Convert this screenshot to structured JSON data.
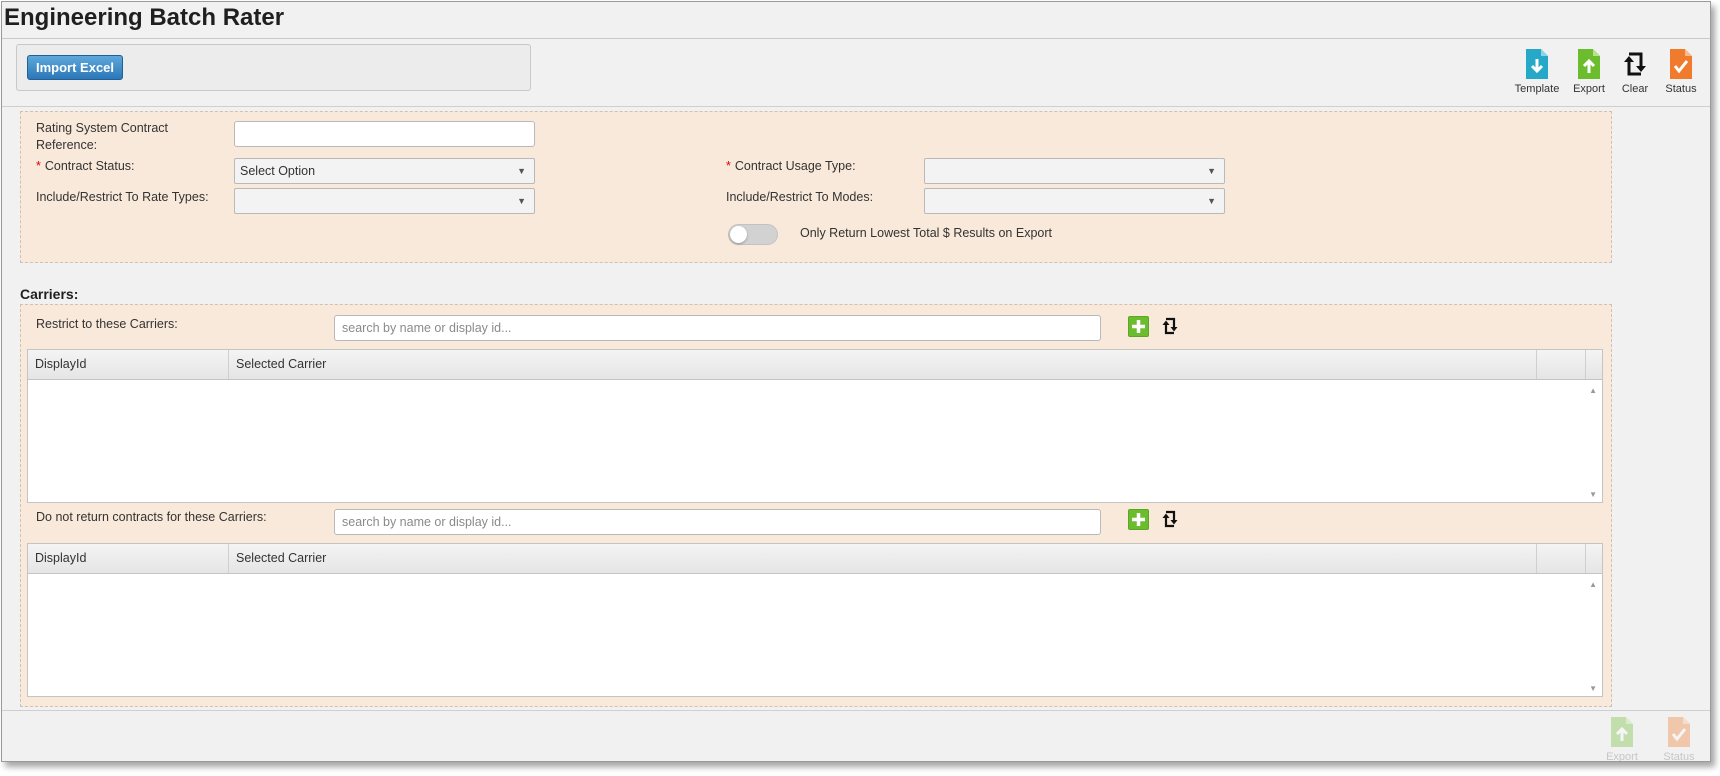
{
  "header": {
    "title": "Engineering Batch Rater"
  },
  "import": {
    "label": "Import Excel"
  },
  "toolbar": [
    {
      "id": "template",
      "label": "Template",
      "icon": "file-download-icon",
      "color": "#26a8c8"
    },
    {
      "id": "export",
      "label": "Export",
      "icon": "file-upload-icon",
      "color": "#6cbd2e"
    },
    {
      "id": "clear",
      "label": "Clear",
      "icon": "refresh-icon",
      "color": "#111111"
    },
    {
      "id": "status",
      "label": "Status",
      "icon": "file-check-icon",
      "color": "#f07b2c"
    }
  ],
  "form": {
    "contract_reference": {
      "label": "Rating System Contract Reference:",
      "value": ""
    },
    "contract_status": {
      "label": "Contract Status:",
      "required": "*",
      "value": "Select Option"
    },
    "contract_usage_type": {
      "label": "Contract Usage Type:",
      "required": "*",
      "value": ""
    },
    "rate_types": {
      "label": "Include/Restrict To Rate Types:",
      "value": ""
    },
    "modes": {
      "label": "Include/Restrict To Modes:",
      "value": ""
    },
    "lowest_total_toggle": {
      "label": "Only Return Lowest Total $ Results on Export",
      "on": false
    }
  },
  "carriers": {
    "title": "Carriers:",
    "restrict": {
      "label": "Restrict to these Carriers:",
      "placeholder": "search by name or display id...",
      "columns": [
        "DisplayId",
        "Selected Carrier"
      ],
      "rows": []
    },
    "exclude": {
      "label": "Do not return contracts for these Carriers:",
      "placeholder": "search by name or display id...",
      "columns": [
        "DisplayId",
        "Selected Carrier"
      ],
      "rows": []
    }
  },
  "footer": [
    {
      "id": "export",
      "label": "Export",
      "icon": "file-upload-icon",
      "enabled": false
    },
    {
      "id": "status",
      "label": "Status",
      "icon": "file-check-icon",
      "enabled": false
    }
  ],
  "colors": {
    "accent_blue": "#2b77b8",
    "panel_background": "#f9e9da",
    "add_green": "#6cbd2e",
    "required_red": "#dd0000"
  }
}
